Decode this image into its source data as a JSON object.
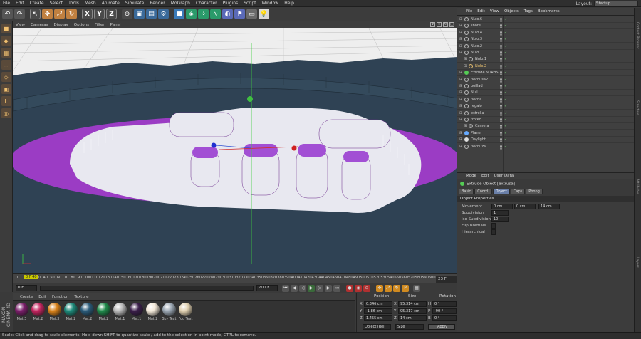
{
  "menubar": {
    "items": [
      "File",
      "Edit",
      "Create",
      "Select",
      "Tools",
      "Mesh",
      "Animate",
      "Simulate",
      "Render",
      "MoGraph",
      "Character",
      "Plugins",
      "Script",
      "Window",
      "Help"
    ],
    "layout_label": "Layout:",
    "layout_value": "Startup"
  },
  "toolbar": {
    "buttons": [
      "undo",
      "redo",
      "live-selection",
      "move",
      "scale",
      "rotate",
      "x-axis",
      "y-axis",
      "z-axis",
      "world-coordinates",
      "render-view",
      "render-picture-viewer",
      "render-settings",
      "cube",
      "subdivision",
      "array",
      "spline",
      "deformer",
      "scene",
      "camera",
      "light"
    ],
    "axis_letters": [
      "X",
      "Y",
      "Z"
    ]
  },
  "viewport": {
    "menu": [
      "View",
      "Cameras",
      "Display",
      "Options",
      "Filter",
      "Panel"
    ],
    "colors": {
      "sky": "#eeeeee",
      "ground": "#2f4254",
      "disk": "#9b3cc4",
      "extrude_top": "#a24fd4",
      "wall": "#e8e8f0"
    }
  },
  "timeline": {
    "ticks": [
      "0",
      "10",
      "20",
      "30",
      "40",
      "50",
      "60",
      "70",
      "80",
      "90",
      "100",
      "110",
      "120",
      "130",
      "140",
      "150",
      "160",
      "170",
      "180",
      "190",
      "200",
      "210",
      "220",
      "230",
      "240",
      "250",
      "260",
      "270",
      "280",
      "290",
      "300",
      "310",
      "320",
      "330",
      "340",
      "350",
      "360",
      "370",
      "380",
      "390",
      "400",
      "410",
      "420",
      "430",
      "440",
      "450",
      "460",
      "470",
      "480",
      "490",
      "500",
      "510",
      "520",
      "530",
      "540",
      "550",
      "560",
      "570",
      "580",
      "590",
      "600"
    ],
    "end_label": "23 F",
    "highlight_label": "0 F 40"
  },
  "transport": {
    "start": "0 F",
    "end": "700 F",
    "current": "0 F"
  },
  "materials": {
    "menu": [
      "Create",
      "Edit",
      "Function",
      "Texture"
    ],
    "logo_text": "MAXON CINEMA 4D",
    "items": [
      {
        "label": "Mat.3",
        "color": "#7a1e6a"
      },
      {
        "label": "Mat.2",
        "color": "#c2245e"
      },
      {
        "label": "Mat.3",
        "color": "#d9821a"
      },
      {
        "label": "Mat.2",
        "color": "#1d8a7a"
      },
      {
        "label": "Mat.2",
        "color": "#2a5b7a"
      },
      {
        "label": "Mat.2",
        "color": "#1f8a4a"
      },
      {
        "label": "Mat.1",
        "color": "#b8b8b8"
      },
      {
        "label": "Mat.1",
        "color": "#3a1e4a"
      },
      {
        "label": "Mat.2",
        "color": "#f2e8d8"
      },
      {
        "label": "Sky Text",
        "color": "#9aa6b2"
      },
      {
        "label": "Fog Text",
        "color": "#e0d0b0"
      }
    ]
  },
  "coordinates": {
    "headers": [
      "Position",
      "Size",
      "Rotation"
    ],
    "rows": [
      {
        "axis": "X",
        "pos": "0.346 cm",
        "size": "95.314 cm",
        "rot_axis": "H",
        "rot": "0 °"
      },
      {
        "axis": "Y",
        "pos": "-1.86 cm",
        "size": "95.317 cm",
        "rot_axis": "P",
        "rot": "-90 °"
      },
      {
        "axis": "Z",
        "pos": "1.455 cm",
        "size": "14 cm",
        "rot_axis": "B",
        "rot": "0 °"
      }
    ],
    "mode_object": "Object (Rel)",
    "mode_size": "Size",
    "apply_label": "Apply"
  },
  "status": {
    "text": "Scale: Click and drag to scale elements. Hold down SHIFT to quantize scale / add to the selection in point mode, CTRL to remove."
  },
  "object_manager": {
    "menu": [
      "File",
      "Edit",
      "View",
      "Objects",
      "Tags",
      "Bookmarks"
    ],
    "objects": [
      {
        "name": "Nulo.6",
        "indent": 0,
        "type": "null"
      },
      {
        "name": "shore",
        "indent": 0,
        "type": "null"
      },
      {
        "name": "Nulo.4",
        "indent": 0,
        "type": "null"
      },
      {
        "name": "Nulo.3",
        "indent": 0,
        "type": "null"
      },
      {
        "name": "Nulo.2",
        "indent": 0,
        "type": "null"
      },
      {
        "name": "Nulo.1",
        "indent": 0,
        "type": "null"
      },
      {
        "name": "Nulo.1",
        "indent": 1,
        "type": "null"
      },
      {
        "name": "Nulo.2",
        "indent": 1,
        "type": "null-highlight"
      },
      {
        "name": "Extrude NURBS",
        "indent": 0,
        "type": "extrude"
      },
      {
        "name": "flechusa2",
        "indent": 0,
        "type": "null"
      },
      {
        "name": "boillad",
        "indent": 0,
        "type": "null"
      },
      {
        "name": "Null",
        "indent": 0,
        "type": "null"
      },
      {
        "name": "flecha",
        "indent": 0,
        "type": "null"
      },
      {
        "name": "regalo",
        "indent": 0,
        "type": "null"
      },
      {
        "name": "estrella",
        "indent": 0,
        "type": "null"
      },
      {
        "name": "trofeo",
        "indent": 0,
        "type": "null"
      },
      {
        "name": "Camera",
        "indent": 1,
        "type": "camera"
      },
      {
        "name": "Plane",
        "indent": 0,
        "type": "plane"
      },
      {
        "name": "Daylight",
        "indent": 0,
        "type": "light"
      },
      {
        "name": "flechuza",
        "indent": 0,
        "type": "null"
      }
    ]
  },
  "attribute_manager": {
    "menu": [
      "Mode",
      "Edit",
      "User Data"
    ],
    "title": "Extrude Object [extrusa]",
    "tabs": [
      "Basic",
      "Coord.",
      "Object",
      "Caps",
      "Phong"
    ],
    "active_tab": "Object",
    "section": "Object Properties",
    "movement_label": "Movement",
    "movement": [
      "0 cm",
      "0 cm",
      "14 cm"
    ],
    "subdivision_label": "Subdivision",
    "subdivision": "1",
    "iso_label": "Iso Subdivision",
    "iso": "10",
    "flip_label": "Flip Normals",
    "hier_label": "Hierarchical"
  },
  "sidestrip": [
    "Content Browser",
    "Structure",
    "Attributes",
    "Layers"
  ]
}
